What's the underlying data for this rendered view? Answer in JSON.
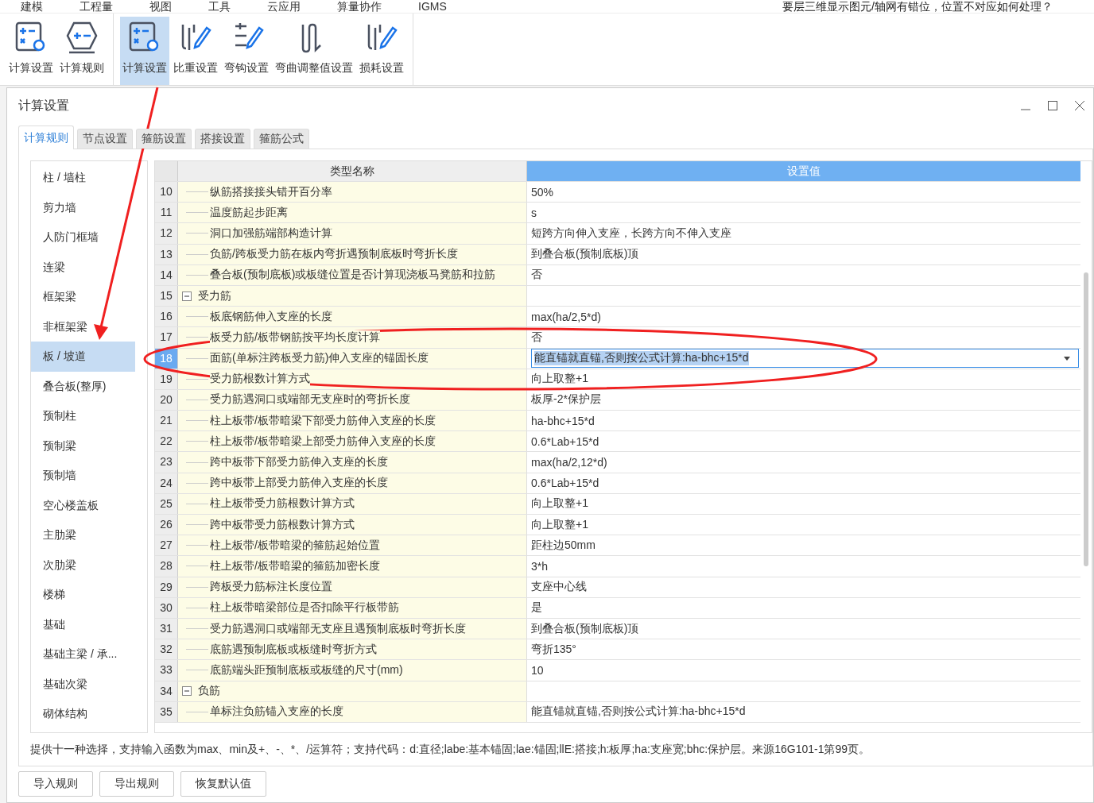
{
  "menu": [
    "建模",
    "工程量",
    "视图",
    "工具",
    "云应用",
    "算量协作",
    "IGMS"
  ],
  "help_question": "要层三维显示图元/轴网有错位，位置不对应如何处理？",
  "ribbon": [
    [
      {
        "label": "计算设置",
        "selected": false
      },
      {
        "label": "计算规则",
        "selected": false
      }
    ],
    [
      {
        "label": "计算设置",
        "selected": true
      },
      {
        "label": "比重设置",
        "selected": false
      },
      {
        "label": "弯钩设置",
        "selected": false
      },
      {
        "label": "弯曲调整值设置",
        "selected": false
      },
      {
        "label": "损耗设置",
        "selected": false
      }
    ]
  ],
  "dialog": {
    "title": "计算设置",
    "tabs": [
      {
        "label": "计算规则",
        "selected": true
      },
      {
        "label": "节点设置",
        "selected": false
      },
      {
        "label": "箍筋设置",
        "selected": false
      },
      {
        "label": "搭接设置",
        "selected": false
      },
      {
        "label": "箍筋公式",
        "selected": false
      }
    ],
    "categories": [
      {
        "label": "柱 / 墙柱",
        "selected": false
      },
      {
        "label": "剪力墙",
        "selected": false
      },
      {
        "label": "人防门框墙",
        "selected": false
      },
      {
        "label": "连梁",
        "selected": false
      },
      {
        "label": "框架梁",
        "selected": false
      },
      {
        "label": "非框架梁",
        "selected": false
      },
      {
        "label": "板 / 坡道",
        "selected": true
      },
      {
        "label": "叠合板(整厚)",
        "selected": false
      },
      {
        "label": "预制柱",
        "selected": false
      },
      {
        "label": "预制梁",
        "selected": false
      },
      {
        "label": "预制墙",
        "selected": false
      },
      {
        "label": "空心楼盖板",
        "selected": false
      },
      {
        "label": "主肋梁",
        "selected": false
      },
      {
        "label": "次肋梁",
        "selected": false
      },
      {
        "label": "楼梯",
        "selected": false
      },
      {
        "label": "基础",
        "selected": false
      },
      {
        "label": "基础主梁 / 承...",
        "selected": false
      },
      {
        "label": "基础次梁",
        "selected": false
      },
      {
        "label": "砌体结构",
        "selected": false
      }
    ],
    "table": {
      "columns": [
        "类型名称",
        "设置值"
      ],
      "rows": [
        {
          "num": "10",
          "kind": "item",
          "name": "纵筋搭接接头错开百分率",
          "value": "50%",
          "selected": false
        },
        {
          "num": "11",
          "kind": "item",
          "name": "温度筋起步距离",
          "value": "s",
          "selected": false
        },
        {
          "num": "12",
          "kind": "item",
          "name": "洞口加强筋端部构造计算",
          "value": "短跨方向伸入支座，长跨方向不伸入支座",
          "selected": false
        },
        {
          "num": "13",
          "kind": "item",
          "name": "负筋/跨板受力筋在板内弯折遇预制底板时弯折长度",
          "value": "到叠合板(预制底板)顶",
          "selected": false
        },
        {
          "num": "14",
          "kind": "item",
          "name": "叠合板(预制底板)或板缝位置是否计算现浇板马凳筋和拉筋",
          "value": "否",
          "selected": false
        },
        {
          "num": "15",
          "kind": "group",
          "name": "受力筋",
          "expanded": true,
          "selected": false
        },
        {
          "num": "16",
          "kind": "item",
          "name": "板底钢筋伸入支座的长度",
          "value": "max(ha/2,5*d)",
          "selected": false
        },
        {
          "num": "17",
          "kind": "item",
          "name": "板受力筋/板带钢筋按平均长度计算",
          "value": "否",
          "selected": false
        },
        {
          "num": "18",
          "kind": "item",
          "name": "面筋(单标注跨板受力筋)伸入支座的锚固长度",
          "value": "能直锚就直锚,否则按公式计算:ha-bhc+15*d",
          "selected": true
        },
        {
          "num": "19",
          "kind": "item",
          "name": "受力筋根数计算方式",
          "value": "向上取整+1",
          "selected": false
        },
        {
          "num": "20",
          "kind": "item",
          "name": "受力筋遇洞口或端部无支座时的弯折长度",
          "value": "板厚-2*保护层",
          "selected": false
        },
        {
          "num": "21",
          "kind": "item",
          "name": "柱上板带/板带暗梁下部受力筋伸入支座的长度",
          "value": "ha-bhc+15*d",
          "selected": false
        },
        {
          "num": "22",
          "kind": "item",
          "name": "柱上板带/板带暗梁上部受力筋伸入支座的长度",
          "value": "0.6*Lab+15*d",
          "selected": false
        },
        {
          "num": "23",
          "kind": "item",
          "name": "跨中板带下部受力筋伸入支座的长度",
          "value": "max(ha/2,12*d)",
          "selected": false
        },
        {
          "num": "24",
          "kind": "item",
          "name": "跨中板带上部受力筋伸入支座的长度",
          "value": "0.6*Lab+15*d",
          "selected": false
        },
        {
          "num": "25",
          "kind": "item",
          "name": "柱上板带受力筋根数计算方式",
          "value": "向上取整+1",
          "selected": false
        },
        {
          "num": "26",
          "kind": "item",
          "name": "跨中板带受力筋根数计算方式",
          "value": "向上取整+1",
          "selected": false
        },
        {
          "num": "27",
          "kind": "item",
          "name": "柱上板带/板带暗梁的箍筋起始位置",
          "value": "距柱边50mm",
          "selected": false
        },
        {
          "num": "28",
          "kind": "item",
          "name": "柱上板带/板带暗梁的箍筋加密长度",
          "value": "3*h",
          "selected": false
        },
        {
          "num": "29",
          "kind": "item",
          "name": "跨板受力筋标注长度位置",
          "value": "支座中心线",
          "selected": false
        },
        {
          "num": "30",
          "kind": "item",
          "name": "柱上板带暗梁部位是否扣除平行板带筋",
          "value": "是",
          "selected": false
        },
        {
          "num": "31",
          "kind": "item",
          "name": "受力筋遇洞口或端部无支座且遇预制底板时弯折长度",
          "value": "到叠合板(预制底板)顶",
          "selected": false
        },
        {
          "num": "32",
          "kind": "item",
          "name": "底筋遇预制底板或板缝时弯折方式",
          "value": "弯折135°",
          "selected": false
        },
        {
          "num": "33",
          "kind": "item",
          "name": "底筋端头距预制底板或板缝的尺寸(mm)",
          "value": "10",
          "selected": false
        },
        {
          "num": "34",
          "kind": "group",
          "name": "负筋",
          "expanded": true,
          "selected": false
        },
        {
          "num": "35",
          "kind": "item",
          "name": "单标注负筋锚入支座的长度",
          "value": "能直锚就直锚,否则按公式计算:ha-bhc+15*d",
          "selected": false
        }
      ]
    },
    "hint": "提供十一种选择，支持输入函数为max、min及+、-、*、/运算符；支持代码：d:直径;labe:基本锚固;lae:锚固;llE:搭接;h:板厚;ha:支座宽;bhc:保护层。来源16G101-1第99页。",
    "buttons": [
      "导入规则",
      "导出规则",
      "恢复默认值"
    ]
  }
}
